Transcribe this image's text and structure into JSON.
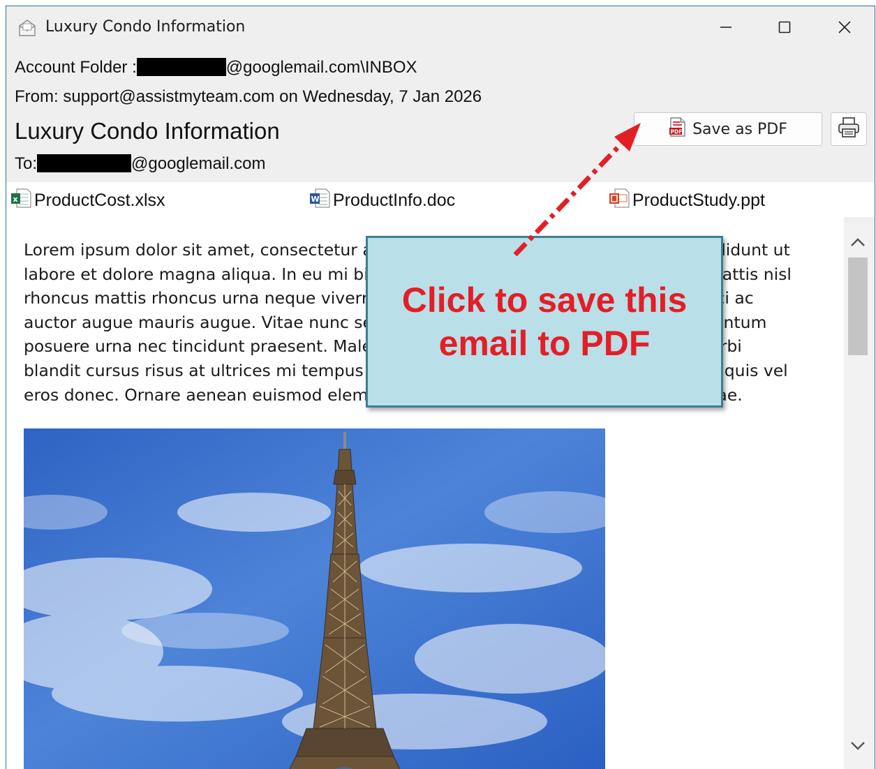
{
  "window": {
    "title": "Luxury Condo Information",
    "controls": [
      "minimize",
      "maximize",
      "close"
    ]
  },
  "header": {
    "account_label": "Account Folder :",
    "account_suffix": "@googlemail.com\\INBOX",
    "from_line": "From: support@assistmyteam.com on Wednesday, 7 Jan 2026",
    "subject": "Luxury Condo Information",
    "to_label": "To:",
    "to_suffix": "@googlemail.com"
  },
  "toolbar": {
    "save_pdf_label": "Save as PDF",
    "save_pdf_icon": "pdf-file-icon",
    "print_icon": "printer-icon"
  },
  "attachments": [
    {
      "name": "ProductCost.xlsx",
      "icon": "excel-file-icon"
    },
    {
      "name": "ProductInfo.doc",
      "icon": "word-file-icon"
    },
    {
      "name": "ProductStudy.ppt",
      "icon": "powerpoint-file-icon"
    }
  ],
  "body": {
    "lines": [
      "Lorem ipsum dolor sit amet, consectetur adipiscing elit, sed do eiusmod tempor incididunt ut",
      "labore et dolore magna aliqua. In eu mi bibendum neque egestas congue quisque. Mattis nisl",
      "rhoncus mattis rhoncus urna neque viverra justo nec ultrices dui sapien. Vivamus orci ac",
      "auctor augue mauris augue. Vitae nunc sed velit dignissim sodales ut eu sem. Fermentum",
      "posuere urna nec tincidunt praesent. Malesuada fames ac turpis egestas integer. Morbi",
      "blandit cursus risus at ultrices mi tempus imperdiet nulla. Sagittis eu volutpat odio a quis vel",
      "eros donec. Ornare aenean euismod elementum nisi quis eleifend quam. Semper vitae."
    ],
    "image": "eiffel-tower-photo"
  },
  "callout": {
    "text_line1": "Click to save this",
    "text_line2": "email to PDF",
    "color": "#e41e26",
    "background": "#b9dfe8"
  }
}
